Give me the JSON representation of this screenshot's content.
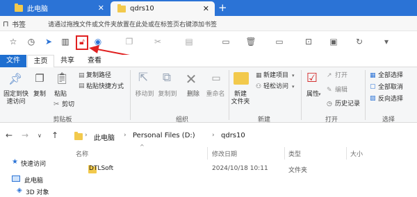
{
  "tabs": [
    {
      "label": "此电脑",
      "close": "✕"
    },
    {
      "label": "qdrs10",
      "close": "✕"
    }
  ],
  "new_tab": "+",
  "bookmarks": {
    "label": "书签",
    "hint": "请通过拖拽文件或文件夹放置在此处或在标签页右键添加书签"
  },
  "ribbon_tabs": {
    "file": "文件",
    "home": "主页",
    "share": "共享",
    "view": "查看"
  },
  "clipboard": {
    "pin_label": "固定到快速访问",
    "copy": "复制",
    "paste": "粘贴",
    "copy_path": "复制路径",
    "paste_shortcut": "粘贴快捷方式",
    "cut": "剪切",
    "group": "剪贴板"
  },
  "organize": {
    "move_to": "移动到",
    "copy_to": "复制到",
    "delete": "删除",
    "rename": "重命名",
    "group": "组织"
  },
  "new": {
    "new_folder_l1": "新建",
    "new_folder_l2": "文件夹",
    "new_item": "新建项目",
    "easy_access": "轻松访问",
    "group": "新建"
  },
  "open": {
    "properties": "属性",
    "open": "打开",
    "edit": "编辑",
    "history": "历史记录",
    "group": "打开"
  },
  "select": {
    "select_all": "全部选择",
    "select_none": "全部取消",
    "invert": "反向选择",
    "group": "选择"
  },
  "breadcrumbs": [
    "此电脑",
    "Personal Files (D:)",
    "qdrs10"
  ],
  "columns": {
    "name": "名称",
    "date": "修改日期",
    "type": "类型",
    "size": "大小"
  },
  "nav_pane": {
    "quick_access": "快速访问",
    "this_pc": "此电脑",
    "objects_3d": "3D 对象"
  },
  "files": [
    {
      "name": "DTLSoft",
      "date": "2024/10/18 10:11",
      "type": "文件夹",
      "size": ""
    }
  ],
  "colors": {
    "accent": "#2b73d6",
    "file_tab": "#1f6fd0",
    "highlight": "#e02020",
    "folder": "#f2c94c"
  }
}
